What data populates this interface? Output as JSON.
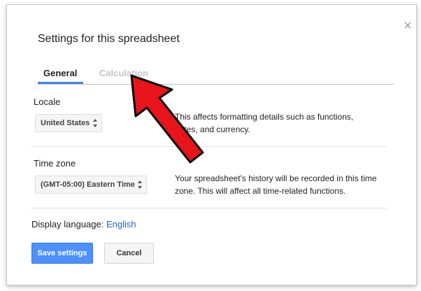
{
  "dialog": {
    "title": "Settings for this spreadsheet",
    "close_icon": "close-icon"
  },
  "tabs": [
    {
      "label": "General",
      "active": true
    },
    {
      "label": "Calculation",
      "active": false
    }
  ],
  "locale": {
    "label": "Locale",
    "selected": "United States",
    "description": "This affects formatting details such as functions, dates, and currency."
  },
  "timezone": {
    "label": "Time zone",
    "selected": "(GMT-05:00) Eastern Time",
    "description": "Your spreadsheet's history will be recorded in this time zone. This will affect all time-related functions."
  },
  "display_language": {
    "label": "Display language:",
    "value": "English"
  },
  "buttons": {
    "save": "Save settings",
    "cancel": "Cancel"
  },
  "colors": {
    "accent": "#4285f4",
    "save_button": "#4d90fe",
    "link": "#1a66c8",
    "annotation_arrow": "#e8141b"
  }
}
